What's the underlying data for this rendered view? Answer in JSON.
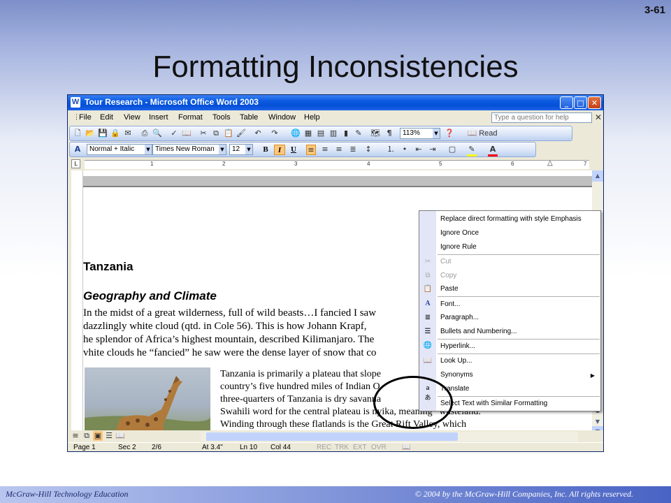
{
  "slide": {
    "number": "3-61",
    "title": "Formatting Inconsistencies",
    "footer_left": "McGraw-Hill Technology Education",
    "footer_right": "© 2004 by the McGraw-Hill Companies, Inc.  All rights reserved."
  },
  "window": {
    "title": "Tour Research - Microsoft Office Word 2003",
    "controls": {
      "minimize": "_",
      "maximize": "□",
      "close": "✕"
    }
  },
  "menubar": {
    "items": [
      "File",
      "Edit",
      "View",
      "Insert",
      "Format",
      "Tools",
      "Table",
      "Window",
      "Help"
    ],
    "ask_placeholder": "Type a question for help",
    "close_glyph": "✕"
  },
  "standard_toolbar": {
    "zoom": "113%",
    "read_label": "Read",
    "icons": [
      "new-icon",
      "open-icon",
      "save-icon",
      "permission-icon",
      "email-icon",
      "print-icon",
      "print-preview-icon",
      "spelling-icon",
      "research-icon",
      "cut-icon",
      "copy-icon",
      "paste-icon",
      "format-painter-icon",
      "undo-icon",
      "redo-icon",
      "hyperlink-icon",
      "tables-borders-icon",
      "insert-table-icon",
      "insert-excel-icon",
      "columns-icon",
      "drawing-icon",
      "document-map-icon",
      "show-formatting-icon"
    ]
  },
  "formatting_toolbar": {
    "style": "Normal + Italic",
    "font": "Times New Roman",
    "size": "12",
    "bold": "B",
    "italic": "I",
    "underline": "U",
    "highlight_color": "#ffff00",
    "font_color": "#ff0000"
  },
  "ruler": {
    "numbers": [
      "1",
      "2",
      "3",
      "4",
      "5",
      "6",
      "7"
    ],
    "tab_selector": "L"
  },
  "document": {
    "heading1": "Tanzania",
    "heading2": "Geography and Climate",
    "paragraph_lines": [
      "In the midst of a great wilderness, full of wild beasts…I fancied I saw",
      "dazzlingly white cloud (qtd. in Cole 56). This is how Johann Krapf,",
      "he splendor of Africa’s highest mountain, described Kilimanjaro. The",
      "vhite clouds he “fancied” he saw were the dense layer of snow that co"
    ],
    "column_lines": [
      "Tanzania is primarily a plateau that slope",
      "country’s five hundred miles of Indian O",
      "three-quarters of Tanzania is dry savanna",
      "Swahili word for the central plateau is nyika, meaning “wasteland.",
      "Winding through these flatlands is the Great Rift Valley, which"
    ]
  },
  "statusbar": {
    "page": "Page  1",
    "sec": "Sec  2",
    "pages": "2/6",
    "at": "At  3.4\"",
    "ln": "Ln  10",
    "col": "Col  44",
    "rec": "REC",
    "trk": "TRK",
    "ext": "EXT",
    "ovr": "OVR"
  },
  "context_menu": {
    "items": [
      {
        "label": "Replace direct formatting with style Emphasis",
        "icon": "",
        "disabled": false
      },
      {
        "label": "Ignore Once",
        "icon": "",
        "disabled": false
      },
      {
        "label": "Ignore Rule",
        "icon": "",
        "disabled": false
      },
      {
        "label": "Cut",
        "icon": "scissors-icon",
        "disabled": true
      },
      {
        "label": "Copy",
        "icon": "copy-icon",
        "disabled": true
      },
      {
        "label": "Paste",
        "icon": "paste-icon",
        "disabled": false
      },
      {
        "label": "Font...",
        "icon": "font-icon",
        "disabled": false
      },
      {
        "label": "Paragraph...",
        "icon": "paragraph-icon",
        "disabled": false
      },
      {
        "label": "Bullets and Numbering...",
        "icon": "bullets-icon",
        "disabled": false
      },
      {
        "label": "Hyperlink...",
        "icon": "hyperlink-icon",
        "disabled": false
      },
      {
        "label": "Look Up...",
        "icon": "research-icon",
        "disabled": false
      },
      {
        "label": "Synonyms",
        "icon": "",
        "disabled": false
      },
      {
        "label": "Translate",
        "icon": "translate-icon",
        "disabled": false
      },
      {
        "label": "Select Text with Similar Formatting",
        "icon": "",
        "disabled": false
      }
    ]
  }
}
